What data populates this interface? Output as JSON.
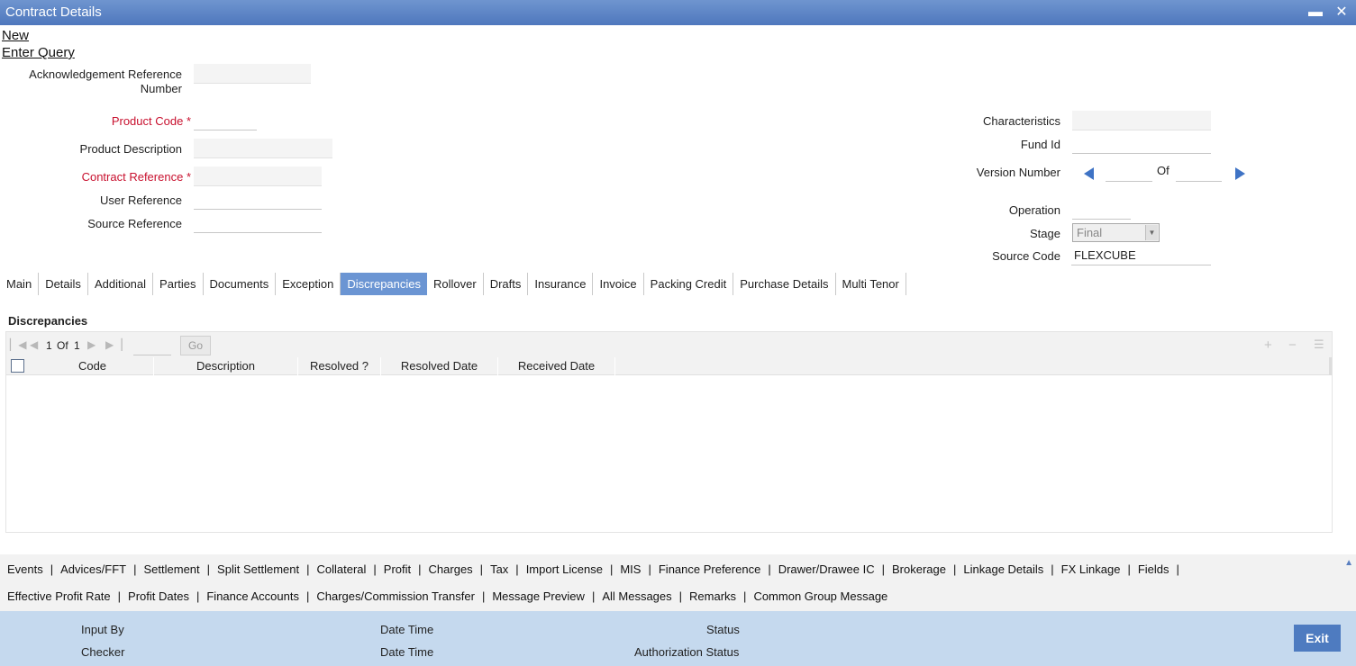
{
  "window": {
    "title": "Contract Details",
    "minimize_glyph": "▬",
    "close_glyph": "✕"
  },
  "actions": {
    "new": "New",
    "enter_query": "Enter Query"
  },
  "form": {
    "ack_ref_label_1": "Acknowledgement Reference",
    "ack_ref_label_2": "Number",
    "ack_ref_value": "",
    "product_code_label": "Product Code",
    "product_code_value": "",
    "product_desc_label": "Product Description",
    "product_desc_value": "",
    "contract_ref_label": "Contract Reference",
    "contract_ref_value": "",
    "user_ref_label": "User Reference",
    "user_ref_value": "",
    "source_ref_label": "Source Reference",
    "source_ref_value": "",
    "required_mark": "*",
    "characteristics_label": "Characteristics",
    "characteristics_value": "",
    "fund_id_label": "Fund Id",
    "fund_id_value": "",
    "version_label": "Version Number",
    "version_value": "",
    "version_of": "Of",
    "version_total": "",
    "operation_label": "Operation",
    "operation_value": "",
    "stage_label": "Stage",
    "stage_value": "Final",
    "source_code_label": "Source Code",
    "source_code_value": "FLEXCUBE"
  },
  "tabs": [
    "Main",
    "Details",
    "Additional",
    "Parties",
    "Documents",
    "Exception",
    "Discrepancies",
    "Rollover",
    "Drafts",
    "Insurance",
    "Invoice",
    "Packing Credit",
    "Purchase Details",
    "Multi Tenor"
  ],
  "active_tab": "Discrepancies",
  "discrepancies": {
    "title": "Discrepancies",
    "pager": {
      "page": "1",
      "of_label": "Of",
      "total": "1",
      "go": "Go"
    },
    "columns": [
      "Code",
      "Description",
      "Resolved ?",
      "Resolved Date",
      "Received Date"
    ]
  },
  "footer_links_row1": [
    "Events",
    "Advices/FFT",
    "Settlement",
    "Split Settlement",
    "Collateral",
    "Profit",
    "Charges",
    "Tax",
    "Import License",
    "MIS",
    "Finance Preference",
    "Drawer/Drawee IC",
    "Brokerage",
    "Linkage Details",
    "FX Linkage",
    "Fields"
  ],
  "footer_links_row2": [
    "Effective Profit Rate",
    "Profit Dates",
    "Finance Accounts",
    "Charges/Commission Transfer",
    "Message Preview",
    "All Messages",
    "Remarks",
    "Common Group Message"
  ],
  "status_bar": {
    "input_by": "Input By",
    "checker": "Checker",
    "date_time_1": "Date Time",
    "date_time_2": "Date Time",
    "status": "Status",
    "auth_status": "Authorization Status",
    "exit": "Exit"
  }
}
